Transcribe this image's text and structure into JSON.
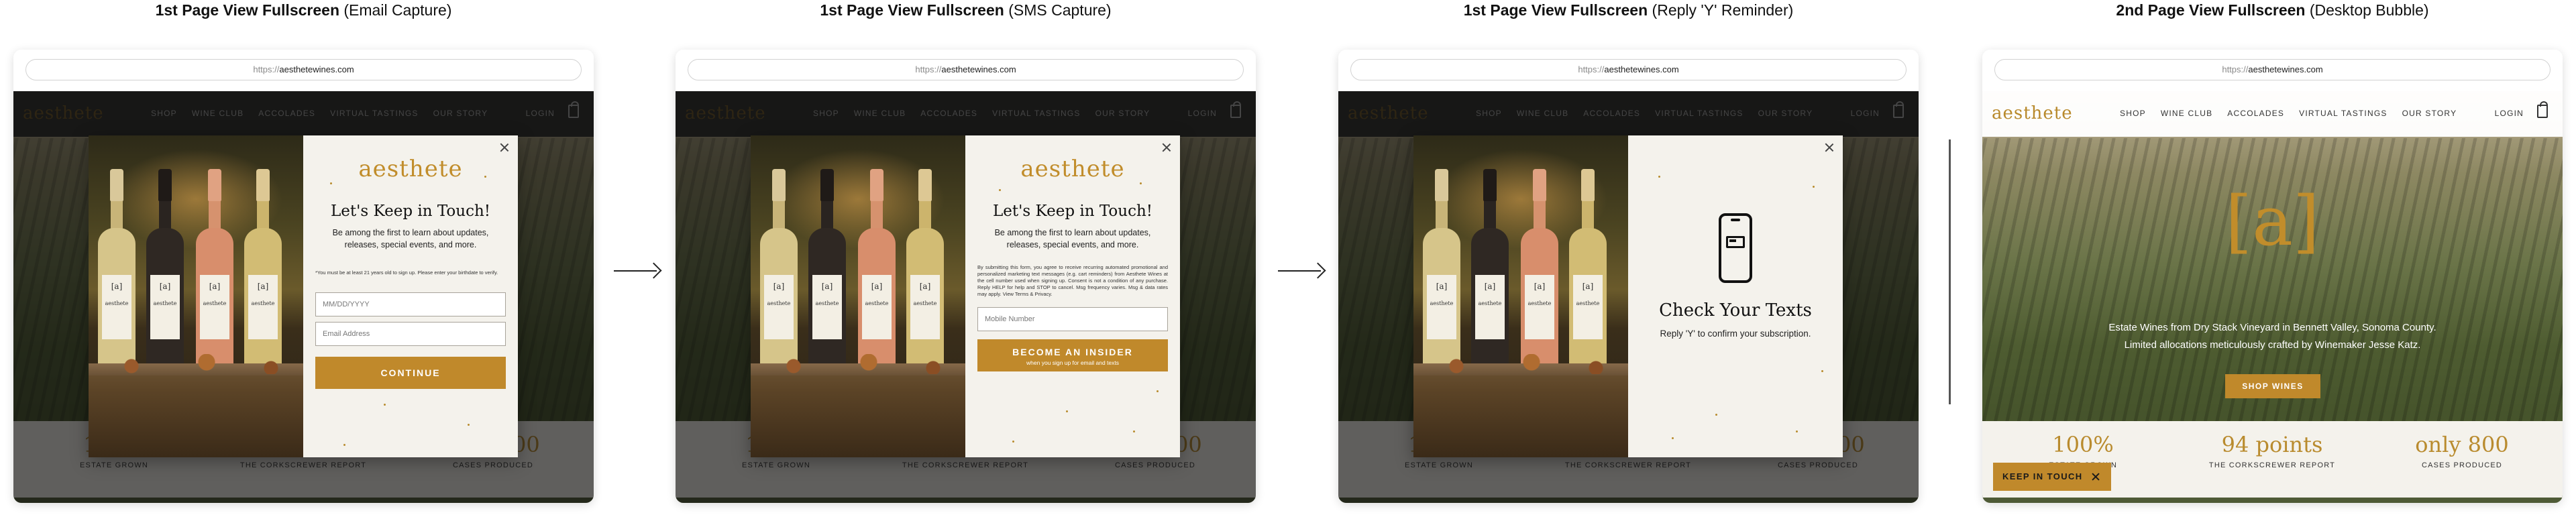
{
  "url": {
    "protocol": "https://",
    "host": "aesthetewines.com"
  },
  "site": {
    "logo": "aesthete",
    "nav": [
      "SHOP",
      "WINE CLUB",
      "ACCOLADES",
      "VIRTUAL TASTINGS",
      "OUR STORY"
    ],
    "login": "LOGIN",
    "hero_mark": "[a]",
    "hero_text_1": "Estate Wines from Dry Stack Vineyard in Bennett Valley, Sonoma County.",
    "hero_text_2": "Limited allocations meticulously crafted by Winemaker Jesse Katz.",
    "shop_button": "SHOP WINES",
    "stats": [
      {
        "num": "100%",
        "label": "ESTATE GROWN"
      },
      {
        "num": "94 points",
        "label": "THE CORKSCREWER REPORT"
      },
      {
        "num": "only 800",
        "label": "CASES PRODUCED"
      }
    ]
  },
  "bottles": [
    {
      "mark": "[a]",
      "name": "aesthete"
    },
    {
      "mark": "[a]",
      "name": "aesthete"
    },
    {
      "mark": "[a]",
      "name": "aesthete"
    },
    {
      "mark": "[a]",
      "name": "aesthete"
    }
  ],
  "panels": [
    {
      "caption_bold": "1st Page View Fullscreen",
      "caption_rest": "(Email Capture)",
      "logo": "aesthete",
      "title": "Let's Keep in Touch!",
      "subtitle": "Be among the first to learn about updates, releases, special events, and more.",
      "fine_print": "*You must be at least 21 years old to sign up. Please enter your birthdate to verify.",
      "dob_placeholder": "MM/DD/YYYY",
      "email_placeholder": "Email Address",
      "button": "CONTINUE"
    },
    {
      "caption_bold": "1st Page View Fullscreen",
      "caption_rest": "(SMS Capture)",
      "logo": "aesthete",
      "title": "Let's Keep in Touch!",
      "subtitle": "Be among the first to learn about updates, releases, special events, and more.",
      "fine_print": "By submitting this form, you agree to receive recurring automated promotional and personalized marketing text messages (e.g. cart reminders) from Aesthete Wines at the cell number used when signing up. Consent is not a condition of any purchase. Reply HELP for help and STOP to cancel. Msg frequency varies. Msg & data rates may apply. View Terms & Privacy.",
      "phone_placeholder": "Mobile Number",
      "button": "BECOME AN INSIDER",
      "button_note": "when you sign up for email and texts"
    },
    {
      "caption_bold": "1st Page View Fullscreen",
      "caption_rest": "(Reply 'Y' Reminder)",
      "title": "Check Your Texts",
      "subtitle": "Reply 'Y' to confirm your subscription."
    },
    {
      "caption_bold": "2nd Page View Fullscreen",
      "caption_rest": "(Desktop Bubble)",
      "bubble": "KEEP IN TOUCH"
    }
  ],
  "colors": {
    "gold": "#c0892b",
    "cream": "#f4f2ec",
    "overlay": "#0c0c0c"
  },
  "icons": [
    "close-icon",
    "arrow-right-icon",
    "shopping-bag-icon",
    "mobile-phone-icon"
  ]
}
